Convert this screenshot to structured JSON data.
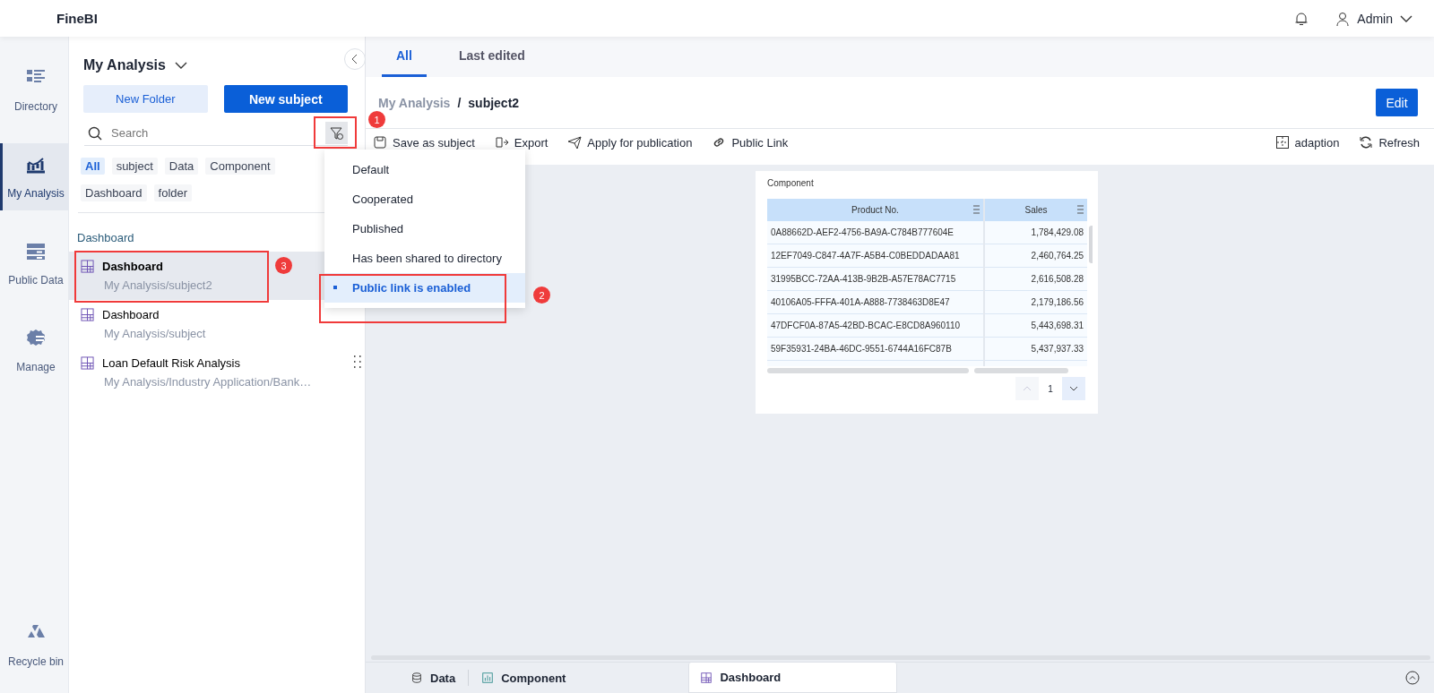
{
  "app": {
    "name": "FineBI"
  },
  "header": {
    "user": "Admin"
  },
  "nav": [
    {
      "label": "Directory",
      "kind": "directory",
      "selected": false
    },
    {
      "label": "My Analysis",
      "kind": "analysis",
      "selected": true
    },
    {
      "label": "Public Data",
      "kind": "data",
      "selected": false
    },
    {
      "label": "Manage",
      "kind": "manage",
      "selected": false
    },
    {
      "label": "Recycle bin",
      "kind": "recycle",
      "selected": false
    }
  ],
  "panel": {
    "title": "My Analysis",
    "buttons": [
      {
        "label": "New Folder",
        "kind": "secondary"
      },
      {
        "label": "New subject",
        "kind": "primary"
      }
    ],
    "search": {
      "placeholder": "Search"
    },
    "filters": [
      {
        "label": "All",
        "selected": true
      },
      {
        "label": "subject",
        "selected": false
      },
      {
        "label": "Data",
        "selected": false
      },
      {
        "label": "Component",
        "selected": false
      },
      {
        "label": "Dashboard",
        "selected": false
      },
      {
        "label": "folder",
        "selected": false
      }
    ],
    "group": "Dashboard",
    "items": [
      {
        "title": "Dashboard",
        "path": "My Analysis/subject2",
        "selected": true
      },
      {
        "title": "Dashboard",
        "path": "My Analysis/subject",
        "selected": false
      },
      {
        "title": "Loan Default Risk Analysis",
        "path": "My Analysis/Industry Application/Bank…",
        "selected": false
      }
    ]
  },
  "tabs": [
    {
      "label": "All",
      "selected": true
    },
    {
      "label": "Last edited",
      "selected": false
    }
  ],
  "breadcrumb": {
    "parent": "My Analysis",
    "separator": "/",
    "current": "subject2"
  },
  "edit_button": "Edit",
  "toolbar": {
    "left": [
      {
        "label": "Save as subject",
        "kind": "save"
      },
      {
        "label": "Export",
        "kind": "export"
      },
      {
        "label": "Apply for publication",
        "kind": "publish"
      },
      {
        "label": "Public Link",
        "kind": "link"
      }
    ],
    "right": [
      {
        "label": "adaption",
        "kind": "adapt"
      },
      {
        "label": "Refresh",
        "kind": "refresh"
      }
    ]
  },
  "filter_menu": {
    "items": [
      {
        "label": "Default",
        "selected": false
      },
      {
        "label": "Cooperated",
        "selected": false
      },
      {
        "label": "Published",
        "selected": false
      },
      {
        "label": "Has been shared to directory",
        "selected": false
      },
      {
        "label": "Public link is enabled",
        "selected": true
      }
    ]
  },
  "card": {
    "title": "Component",
    "columns": [
      "Product No.",
      "Sales"
    ],
    "rows": [
      [
        "0A88662D-AEF2-4756-BA9A-C784B777604E",
        "1,784,429.08"
      ],
      [
        "12EF7049-C847-4A7F-A5B4-C0BEDDADAA81",
        "2,460,764.25"
      ],
      [
        "31995BCC-72AA-413B-9B2B-A57E78AC7715",
        "2,616,508.28"
      ],
      [
        "40106A05-FFFA-401A-A888-7738463D8E47",
        "2,179,186.56"
      ],
      [
        "47DFCF0A-87A5-42BD-BCAC-E8CD8A960110",
        "5,443,698.31"
      ],
      [
        "59F35931-24BA-46DC-9551-6744A16FC87B",
        "5,437,937.33"
      ]
    ],
    "page": "1"
  },
  "bottom_tabs": [
    {
      "label": "Data",
      "kind": "data",
      "selected": false
    },
    {
      "label": "Component",
      "kind": "component",
      "selected": false
    },
    {
      "label": "Dashboard",
      "kind": "dashboard",
      "selected": true
    }
  ],
  "annotations": [
    {
      "label": "1"
    },
    {
      "label": "2"
    },
    {
      "label": "3"
    }
  ]
}
